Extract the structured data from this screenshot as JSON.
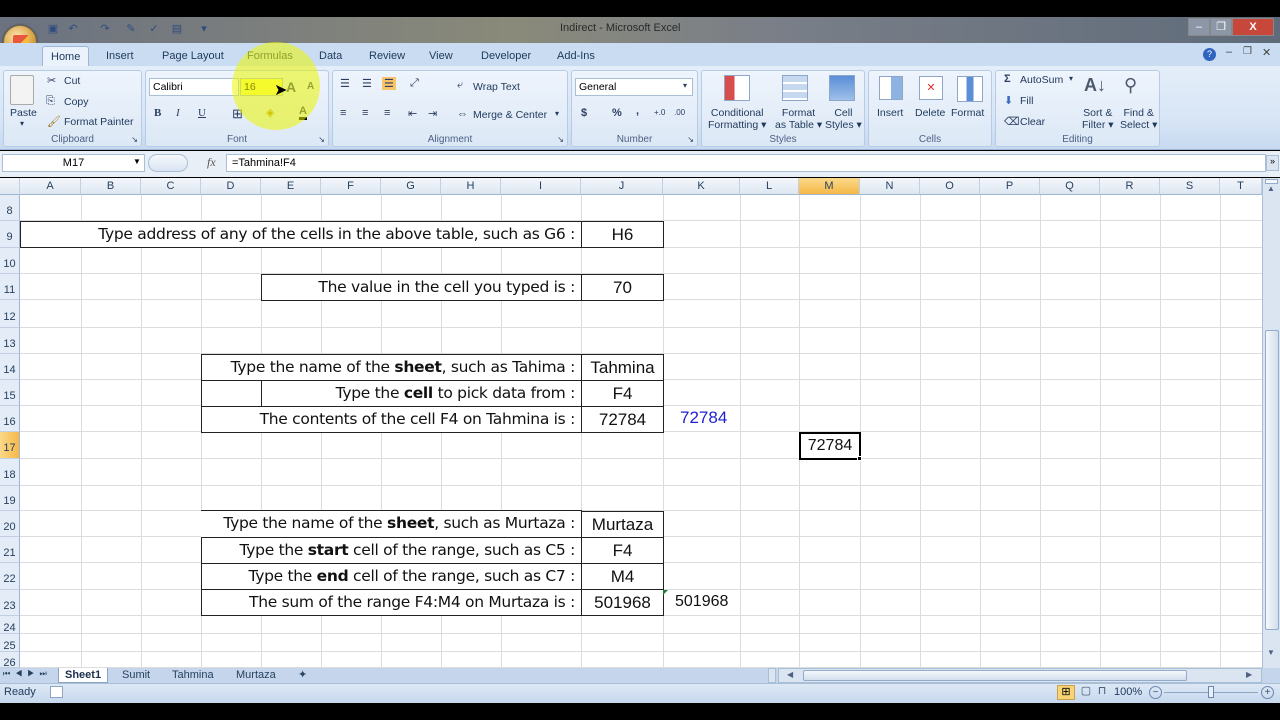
{
  "window": {
    "title": "Indirect - Microsoft Excel",
    "controls": {
      "minimize": "–",
      "restore": "❐",
      "close": "X"
    }
  },
  "quick_access": [
    {
      "name": "save-icon",
      "glyph": "💾"
    },
    {
      "name": "undo-icon",
      "glyph": "↶"
    },
    {
      "name": "redo-icon",
      "glyph": "↷"
    },
    {
      "name": "comment-icon",
      "glyph": "✎"
    },
    {
      "name": "spelling-icon",
      "glyph": "✓"
    },
    {
      "name": "print-preview-icon",
      "glyph": "▤"
    },
    {
      "name": "customize-icon",
      "glyph": "▾"
    }
  ],
  "ribbon_tabs": [
    "Home",
    "Insert",
    "Page Layout",
    "Formulas",
    "Data",
    "Review",
    "View",
    "Developer",
    "Add-Ins"
  ],
  "active_tab": "Home",
  "ribbon": {
    "clipboard": {
      "label": "Clipboard",
      "paste": "Paste",
      "cut": "Cut",
      "copy": "Copy",
      "format_painter": "Format Painter"
    },
    "font": {
      "label": "Font",
      "font_name": "Calibri",
      "font_size": "16",
      "bold": "B",
      "italic": "I",
      "underline": "U",
      "grow": "A",
      "shrink": "A"
    },
    "alignment": {
      "label": "Alignment",
      "wrap_text": "Wrap Text",
      "merge_center": "Merge & Center"
    },
    "number": {
      "label": "Number",
      "format": "General",
      "currency": "$",
      "percent": "%",
      "comma": ",",
      "inc_decimal": "+.0",
      "dec_decimal": ".00"
    },
    "styles": {
      "label": "Styles",
      "conditional_formatting": [
        "Conditional",
        "Formatting"
      ],
      "format_as_table": [
        "Format",
        "as Table"
      ],
      "cell_styles": [
        "Cell",
        "Styles"
      ]
    },
    "cells": {
      "label": "Cells",
      "insert": "Insert",
      "delete": "Delete",
      "format": "Format"
    },
    "editing": {
      "label": "Editing",
      "autosum": "AutoSum",
      "fill": "Fill",
      "clear": "Clear",
      "sort_filter": [
        "Sort &",
        "Filter"
      ],
      "find_select": [
        "Find &",
        "Select"
      ]
    }
  },
  "formula_bar": {
    "name_box": "M17",
    "fx": "fx",
    "formula": "=Tahmina!F4"
  },
  "columns": [
    "A",
    "B",
    "C",
    "D",
    "E",
    "F",
    "G",
    "H",
    "I",
    "J",
    "K",
    "L",
    "M",
    "N",
    "O",
    "P",
    "Q",
    "R",
    "S",
    "T"
  ],
  "selected_column": "M",
  "rows": [
    "8",
    "9",
    "10",
    "11",
    "12",
    "13",
    "14",
    "15",
    "16",
    "17",
    "18",
    "19",
    "20",
    "21",
    "22",
    "23",
    "24",
    "25",
    "26"
  ],
  "selected_row": "17",
  "sheet": {
    "r9_label": "Type address of any of the cells in the above table, such as G6 :",
    "r9_value": "H6",
    "r11_label": "The value in the cell you typed is :",
    "r11_value": "70",
    "r14_label": {
      "pre": "Type the name of the ",
      "bold": "sheet",
      "post": ", such as Tahima :"
    },
    "r14_value": "Tahmina",
    "r15_label": {
      "pre": "Type the ",
      "bold": "cell",
      "post": " to pick data from :"
    },
    "r15_value": "F4",
    "r16_label": "The contents of the cell F4 on Tahmina is :",
    "r16_value": "72784",
    "k16_value": "72784",
    "m17_value": "72784",
    "r20_label": {
      "pre": "Type the name of the ",
      "bold": "sheet",
      "post": ", such as Murtaza :"
    },
    "r20_value": "Murtaza",
    "r21_label": {
      "pre": "Type the ",
      "bold": "start",
      "post": " cell of the range, such as C5 :"
    },
    "r21_value": "F4",
    "r22_label": {
      "pre": "Type the ",
      "bold": "end",
      "post": " cell of the range, such as C7 :"
    },
    "r22_value": "M4",
    "r23_label": "The sum of the range F4:M4 on Murtaza is :",
    "r23_value": "501968",
    "k23_value": "501968",
    "colors": {
      "k16_text": "#1f1fd0",
      "selection_header": "#f5b848"
    }
  },
  "sheet_tabs": [
    "Sheet1",
    "Sumit",
    "Tahmina",
    "Murtaza"
  ],
  "active_sheet": "Sheet1",
  "status": {
    "text": "Ready",
    "zoom": "100%"
  }
}
